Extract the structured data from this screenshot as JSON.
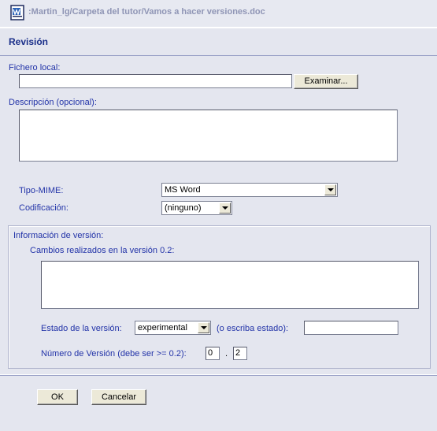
{
  "window": {
    "title": ":Martin_lg/Carpeta del tutor/Vamos a hacer versiones.doc",
    "icon": "word-document-icon"
  },
  "section": {
    "title": "Revisión"
  },
  "form": {
    "local_file": {
      "label": "Fichero local:",
      "value": "",
      "browse_label": "Examinar..."
    },
    "description": {
      "label": "Descripción (opcional):",
      "value": ""
    },
    "mime": {
      "label": "Tipo-MIME:",
      "selected": "MS Word"
    },
    "encoding": {
      "label": "Codificación:",
      "selected": "(ninguno)"
    }
  },
  "version_info": {
    "legend": "Información de versión:",
    "changes_label": "Cambios realizados en la versión 0.2:",
    "changes_value": "",
    "state_label": "Estado de la versión:",
    "state_selected": "experimental",
    "state_write_label": "(o escriba estado):",
    "state_write_value": "",
    "number_label": "Número de Versión (debe ser >= 0.2):",
    "major": "0",
    "dot": ".",
    "minor": "2"
  },
  "buttons": {
    "ok": "OK",
    "cancel": "Cancelar"
  }
}
